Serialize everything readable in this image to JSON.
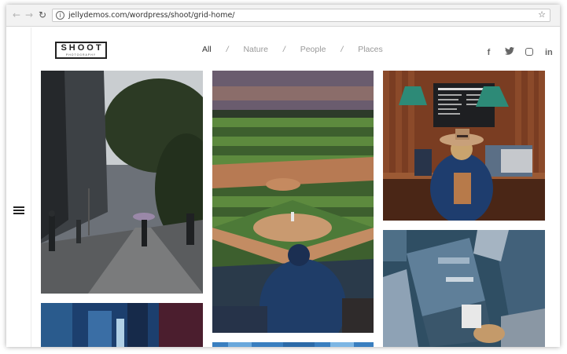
{
  "browser": {
    "url": "jellydemos.com/wordpress/shoot/grid-home/",
    "back_glyph": "←",
    "forward_glyph": "→",
    "reload_glyph": "↻",
    "info_glyph": "i",
    "star_glyph": "☆"
  },
  "site": {
    "logo_word": "SHOOT",
    "logo_sub": "PHOTOGRAPHY"
  },
  "filters": {
    "items": [
      "All",
      "Nature",
      "People",
      "Places"
    ],
    "separator": "/",
    "active": "All"
  },
  "social": {
    "facebook": "f",
    "twitter": "t",
    "linkedin": "in",
    "icons": [
      "facebook-icon",
      "twitter-icon",
      "instagram-icon",
      "linkedin-icon"
    ]
  },
  "grid": {
    "tiles": [
      {
        "name": "photo-city-street-umbrella"
      },
      {
        "name": "photo-baseball-stadium"
      },
      {
        "name": "photo-coffee-shop-woman-hat"
      },
      {
        "name": "photo-city-aerial"
      },
      {
        "name": "photo-street-blue"
      },
      {
        "name": "photo-water-blue"
      }
    ]
  }
}
